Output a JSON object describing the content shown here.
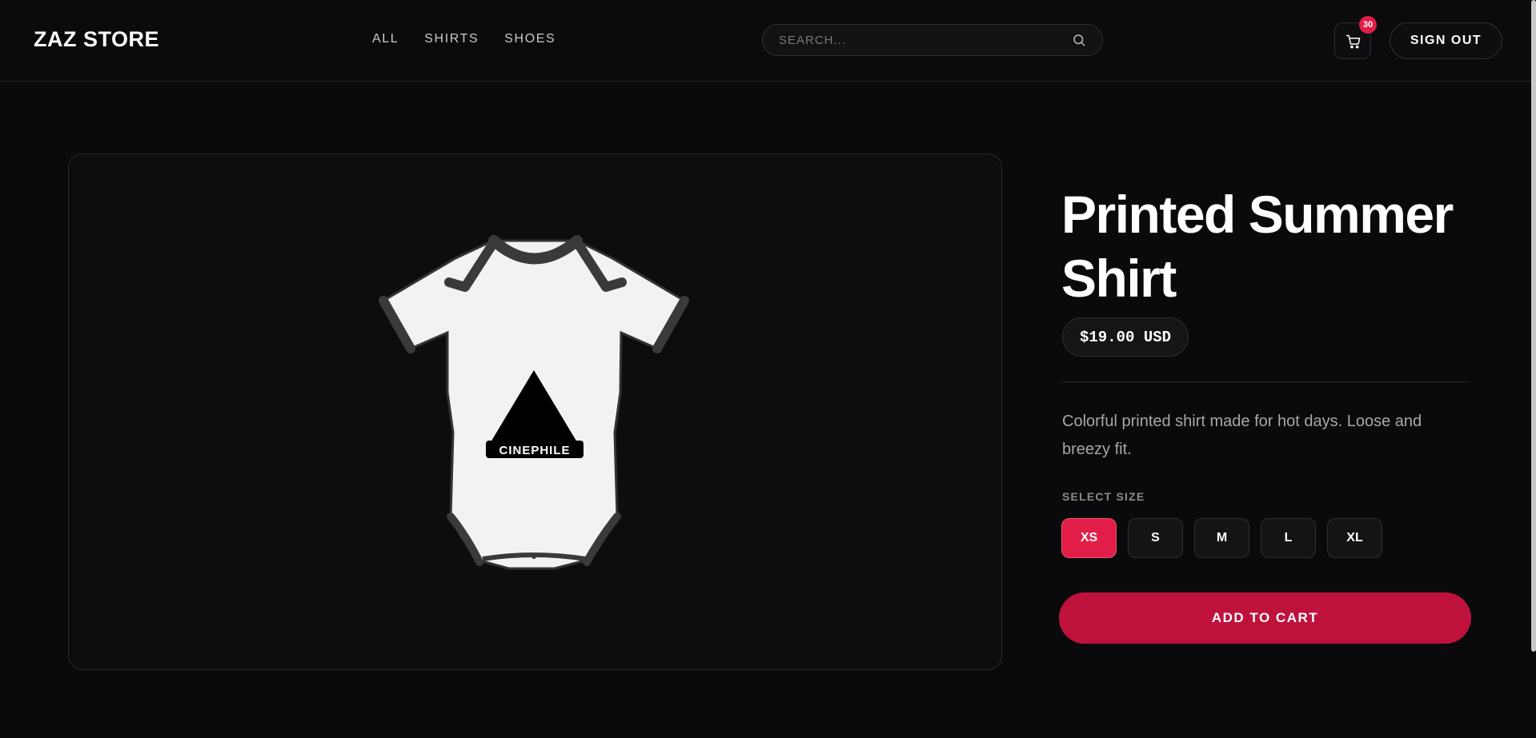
{
  "header": {
    "logo": "ZAZ STORE",
    "nav": [
      "ALL",
      "SHIRTS",
      "SHOES"
    ],
    "search_placeholder": "SEARCH...",
    "cart_count": "30",
    "sign_out_label": "SIGN OUT"
  },
  "product": {
    "title": "Printed Summer Shirt",
    "price": "$19.00 USD",
    "description": "Colorful printed shirt made for hot days. Loose and breezy fit.",
    "size_label": "SELECT SIZE",
    "sizes": [
      "XS",
      "S",
      "M",
      "L",
      "XL"
    ],
    "selected_size": "XS",
    "add_to_cart_label": "ADD TO CART",
    "print_text": "CINEPHILE"
  },
  "colors": {
    "accent": "#e11d48",
    "accent_dark": "#be123c",
    "background": "#0a0a0c"
  },
  "icons": [
    "search-icon",
    "cart-icon"
  ]
}
